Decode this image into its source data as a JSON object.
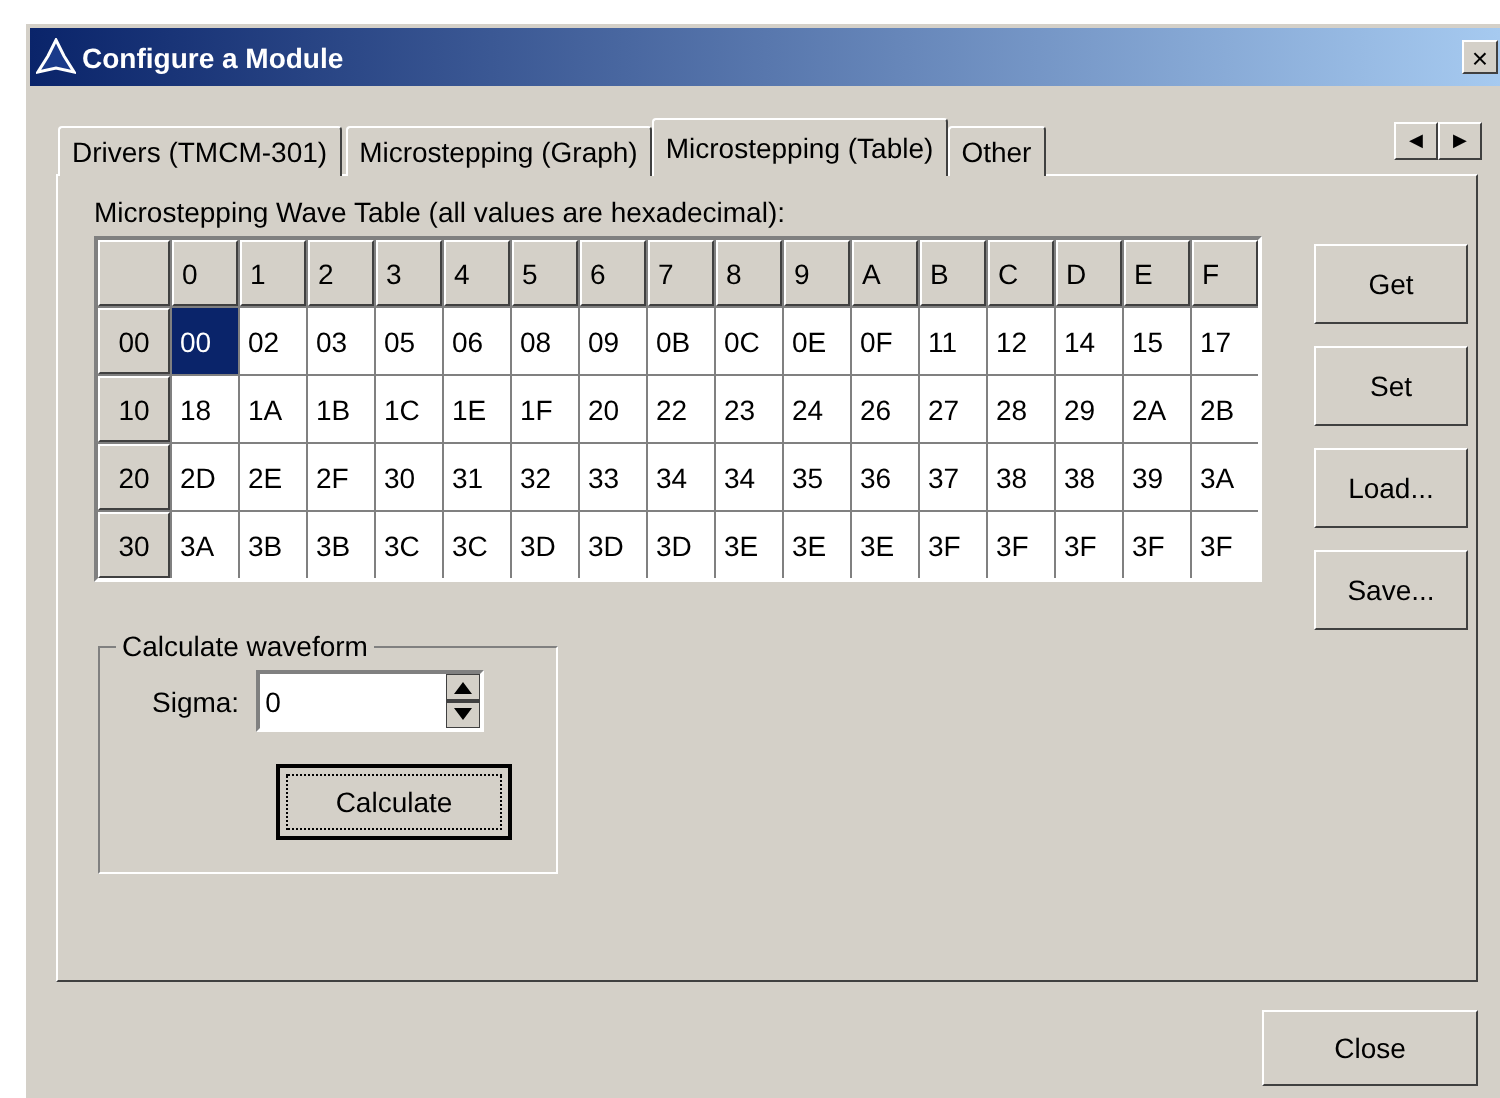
{
  "window": {
    "title": "Configure a Module",
    "close": "×"
  },
  "tabs": [
    {
      "label": "Drivers (TMCM-301)",
      "selected": false
    },
    {
      "label": "Microstepping (Graph)",
      "selected": false
    },
    {
      "label": "Microstepping (Table)",
      "selected": true
    },
    {
      "label": "Other",
      "selected": false
    }
  ],
  "tab_scroll": [
    "◀",
    "▶"
  ],
  "table": {
    "caption": "Microstepping Wave Table (all values are hexadecimal):",
    "columns": [
      "0",
      "1",
      "2",
      "3",
      "4",
      "5",
      "6",
      "7",
      "8",
      "9",
      "A",
      "B",
      "C",
      "D",
      "E",
      "F"
    ],
    "rows": [
      {
        "header": "00",
        "cells": [
          {
            "value": "00",
            "selected": true
          },
          {
            "value": "02",
            "selected": false
          },
          {
            "value": "03",
            "selected": false
          },
          {
            "value": "05",
            "selected": false
          },
          {
            "value": "06",
            "selected": false
          },
          {
            "value": "08",
            "selected": false
          },
          {
            "value": "09",
            "selected": false
          },
          {
            "value": "0B",
            "selected": false
          },
          {
            "value": "0C",
            "selected": false
          },
          {
            "value": "0E",
            "selected": false
          },
          {
            "value": "0F",
            "selected": false
          },
          {
            "value": "11",
            "selected": false
          },
          {
            "value": "12",
            "selected": false
          },
          {
            "value": "14",
            "selected": false
          },
          {
            "value": "15",
            "selected": false
          },
          {
            "value": "17",
            "selected": false
          }
        ]
      },
      {
        "header": "10",
        "cells": [
          {
            "value": "18",
            "selected": false
          },
          {
            "value": "1A",
            "selected": false
          },
          {
            "value": "1B",
            "selected": false
          },
          {
            "value": "1C",
            "selected": false
          },
          {
            "value": "1E",
            "selected": false
          },
          {
            "value": "1F",
            "selected": false
          },
          {
            "value": "20",
            "selected": false
          },
          {
            "value": "22",
            "selected": false
          },
          {
            "value": "23",
            "selected": false
          },
          {
            "value": "24",
            "selected": false
          },
          {
            "value": "26",
            "selected": false
          },
          {
            "value": "27",
            "selected": false
          },
          {
            "value": "28",
            "selected": false
          },
          {
            "value": "29",
            "selected": false
          },
          {
            "value": "2A",
            "selected": false
          },
          {
            "value": "2B",
            "selected": false
          }
        ]
      },
      {
        "header": "20",
        "cells": [
          {
            "value": "2D",
            "selected": false
          },
          {
            "value": "2E",
            "selected": false
          },
          {
            "value": "2F",
            "selected": false
          },
          {
            "value": "30",
            "selected": false
          },
          {
            "value": "31",
            "selected": false
          },
          {
            "value": "32",
            "selected": false
          },
          {
            "value": "33",
            "selected": false
          },
          {
            "value": "34",
            "selected": false
          },
          {
            "value": "34",
            "selected": false
          },
          {
            "value": "35",
            "selected": false
          },
          {
            "value": "36",
            "selected": false
          },
          {
            "value": "37",
            "selected": false
          },
          {
            "value": "38",
            "selected": false
          },
          {
            "value": "38",
            "selected": false
          },
          {
            "value": "39",
            "selected": false
          },
          {
            "value": "3A",
            "selected": false
          }
        ]
      },
      {
        "header": "30",
        "cells": [
          {
            "value": "3A",
            "selected": false
          },
          {
            "value": "3B",
            "selected": false
          },
          {
            "value": "3B",
            "selected": false
          },
          {
            "value": "3C",
            "selected": false
          },
          {
            "value": "3C",
            "selected": false
          },
          {
            "value": "3D",
            "selected": false
          },
          {
            "value": "3D",
            "selected": false
          },
          {
            "value": "3D",
            "selected": false
          },
          {
            "value": "3E",
            "selected": false
          },
          {
            "value": "3E",
            "selected": false
          },
          {
            "value": "3E",
            "selected": false
          },
          {
            "value": "3F",
            "selected": false
          },
          {
            "value": "3F",
            "selected": false
          },
          {
            "value": "3F",
            "selected": false
          },
          {
            "value": "3F",
            "selected": false
          },
          {
            "value": "3F",
            "selected": false
          }
        ]
      }
    ]
  },
  "side_buttons": [
    {
      "label": "Get"
    },
    {
      "label": "Set"
    },
    {
      "label": "Load..."
    },
    {
      "label": "Save..."
    }
  ],
  "waveform": {
    "title": "Calculate waveform",
    "sigma_label": "Sigma:",
    "sigma_value": "0",
    "calculate": {
      "label": "Calculate",
      "focused": true
    }
  },
  "close_button": {
    "label": "Close"
  }
}
